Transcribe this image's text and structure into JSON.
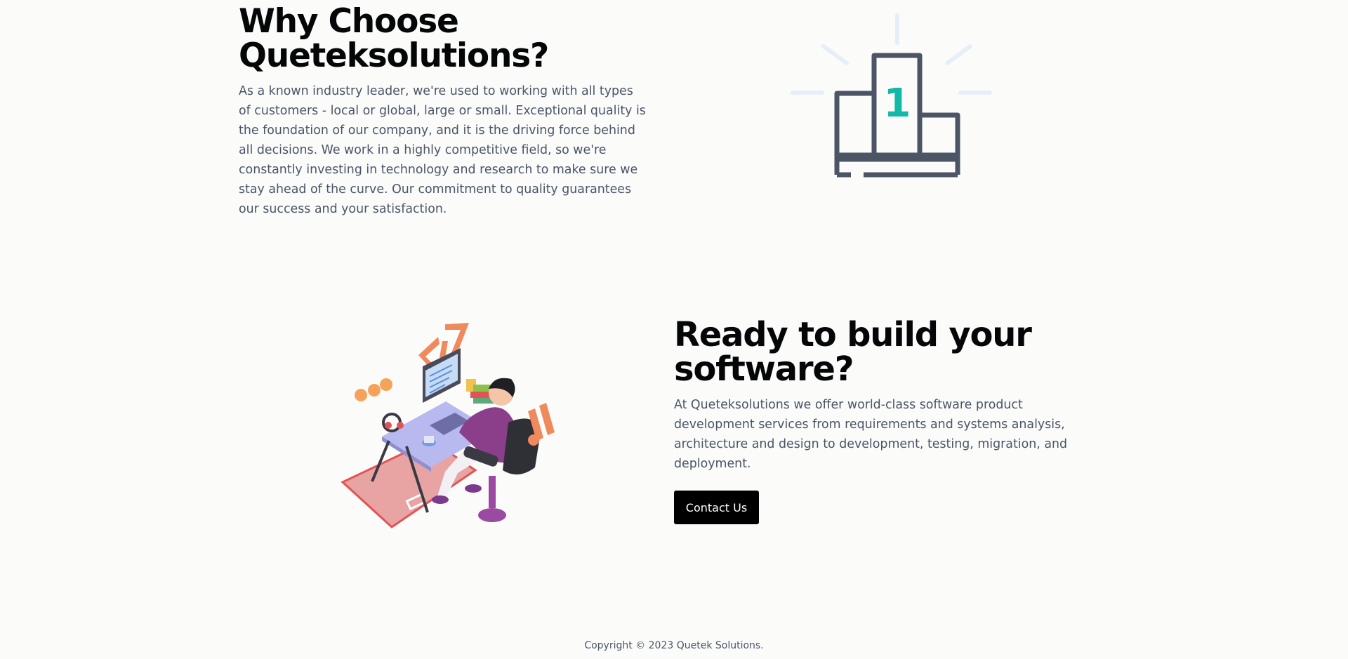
{
  "why": {
    "title_line1": "Why Choose",
    "title_line2": "Queteksolutions?",
    "body": "As a known industry leader, we're used to working with all types of customers - local or global, large or small. Exceptional quality is the foundation of our company, and it is the driving force behind all decisions. We work in a highly competitive field, so we're constantly investing in technology and research to make sure we stay ahead of the curve. Our commitment to quality guarantees our success and your satisfaction.",
    "illustration_icon": "podium-first-place-icon",
    "podium_number": "1"
  },
  "ready": {
    "title_line1": "Ready to build your",
    "title_line2": "software?",
    "body": "At Queteksolutions we offer world-class software product development services from requirements and systems analysis, architecture and design to development, testing, migration, and deployment.",
    "cta_label": "Contact Us",
    "illustration_icon": "developer-at-desk-illustration"
  },
  "footer": {
    "copyright": "Copyright © 2023 Quetek Solutions."
  },
  "colors": {
    "background": "#fbfcfa",
    "heading": "#050608",
    "body_text": "#4a5467",
    "podium_stroke": "#4b5566",
    "podium_accent": "#14b8a6",
    "rays": "#e6eef8",
    "cta_bg": "#000000"
  }
}
